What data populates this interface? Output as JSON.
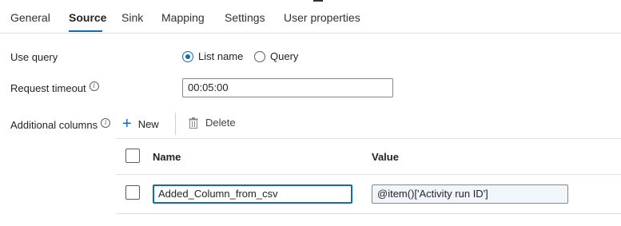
{
  "tabs": [
    {
      "label": "General"
    },
    {
      "label": "Source"
    },
    {
      "label": "Sink"
    },
    {
      "label": "Mapping"
    },
    {
      "label": "Settings"
    },
    {
      "label": "User properties"
    }
  ],
  "active_tab": "Source",
  "use_query": {
    "label": "Use query",
    "options": [
      {
        "label": "List name",
        "selected": true
      },
      {
        "label": "Query",
        "selected": false
      }
    ]
  },
  "request_timeout": {
    "label": "Request timeout",
    "value": "00:05:00"
  },
  "additional_columns": {
    "label": "Additional columns",
    "new_label": "New",
    "delete_label": "Delete",
    "headers": {
      "name": "Name",
      "value": "Value"
    },
    "rows": [
      {
        "name": "Added_Column_from_csv",
        "value": "@item()['Activity run ID']"
      }
    ]
  },
  "icons": {
    "info": "info-icon",
    "add": "plus-icon",
    "delete": "trash-icon"
  },
  "colors": {
    "accent": "#0f6cbd"
  }
}
